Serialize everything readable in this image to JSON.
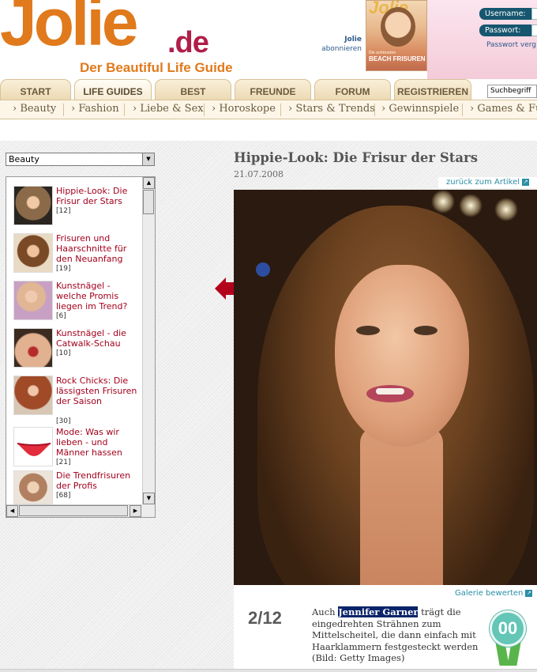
{
  "header": {
    "logo": "Jolie",
    "logo_tld": ".de",
    "tagline": "Der Beautiful Life Guide",
    "magazine_link": "Jolie",
    "subscribe_label": "abonnieren",
    "magazine_cover_title": "Jolie",
    "magazine_cover_text": "BEACH FRISUREN",
    "magazine_cover_small": "Die schönsten"
  },
  "login": {
    "username_label": "Username:",
    "password_label": "Passwort:",
    "forgot_label": "Passwort verg"
  },
  "main_nav": {
    "tabs": [
      "START",
      "LIFE GUIDES",
      "BEST",
      "FREUNDE FINDEN",
      "FORUM",
      "REGISTRIEREN"
    ],
    "active_tab": "LIFE GUIDES",
    "search_placeholder": "Suchbegriff"
  },
  "sub_nav": [
    "› Beauty",
    "› Fashion",
    "› Liebe & Sex",
    "› Horoskope",
    "› Stars & Trends",
    "› Gewinnspiele",
    "› Games & Fun"
  ],
  "sidebar": {
    "category_selected": "Beauty",
    "galleries": [
      {
        "title": "Hippie-Look: Die Frisur der Stars",
        "count": "[12]"
      },
      {
        "title": "Frisuren und Haarschnitte für den Neuanfang",
        "count": "[19]"
      },
      {
        "title": "Kunstnägel - welche Promis liegen im Trend?",
        "count": "[6]"
      },
      {
        "title": "Kunstnägel - die Catwalk-Schau",
        "count": "[10]"
      },
      {
        "title": "Rock Chicks: Die lässigsten Frisuren der Saison",
        "count": "[30]"
      },
      {
        "title": "Mode: Was wir lieben - und Männer hassen",
        "count": "[21]"
      },
      {
        "title": "Die Trendfrisuren der Profis",
        "count": "[68]"
      }
    ]
  },
  "article": {
    "title": "Hippie-Look: Die Frisur der Stars",
    "date": "21.07.2008",
    "back_link": "zurück zum Artikel",
    "rate_link": "Galerie bewerten",
    "counter": "2/12",
    "caption_before": "Auch ",
    "caption_highlight": "Jennifer Garner",
    "caption_after": " trägt die eingedrehten Strähnen zum Mittelscheitel, die dann einfach mit Haarklammern festgesteckt werden (Bild: Getty Images)",
    "rating_badge": "00"
  },
  "colors": {
    "brand_orange": "#e07a1c",
    "brand_red": "#b01e4a",
    "link_red": "#a3001c",
    "link_teal": "#2a8ea6",
    "login_pill": "#16566f",
    "badge_teal": "#63c6b6"
  }
}
